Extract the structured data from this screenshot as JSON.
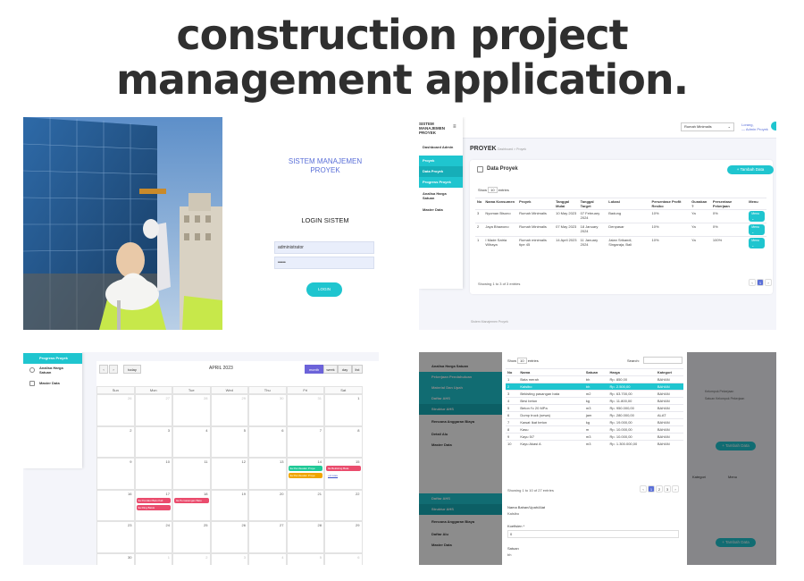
{
  "headline": {
    "line1": "construction project",
    "line2": "management application."
  },
  "login": {
    "title": "SISTEM MANAJEMEN PROYEK",
    "subtitle": "LOGIN SISTEM",
    "username_value": "administrator",
    "password_value": "•••••",
    "button_label": "LOGIN"
  },
  "proyek": {
    "sidebar_title": "SISTEM MANAJEMEN PROYEK",
    "sidebar_items": [
      "Dashboard Admin",
      "Proyek",
      "Data Proyek",
      "Progress Proyek",
      "Analisa Harga Satuan",
      "Master Data"
    ],
    "top_select": "Rumah Minimalis",
    "user_line1": "Lorang,",
    "user_line2": "— Admin Proyek",
    "page_title": "PROYEK",
    "breadcrumb": "Dashboard  >  Proyek",
    "card_title": "Data Proyek",
    "add_button": "+ Tambah Data",
    "show_label": "Show",
    "show_value": "10",
    "entries_label": "entries",
    "columns": [
      "No",
      "Nama Konsumen",
      "Proyek",
      "Tanggal Mulai",
      "Tanggal Target",
      "Lokasi",
      "Persentase Profit Resiko",
      "Gunakan ?",
      "Persentase Pekerjaan",
      "Menu"
    ],
    "rows": [
      [
        "3",
        "Nyoman Bisono",
        "Rumah Minimalis",
        "10 May 2023",
        "07 February 2024",
        "Badung",
        "10%",
        "Ya",
        "0%",
        "Menu ⌄"
      ],
      [
        "2",
        "Jaya Bhawono",
        "Rumah Minimalis",
        "07 May 2023",
        "18 January 2024",
        "Denpasar",
        "10%",
        "Ya",
        "0%",
        "Menu ⌄"
      ],
      [
        "1",
        "I Made Satria Wihaya",
        "Rumah minimalis tipe 45",
        "14 April 2023",
        "11 January 2024",
        "Jalan Srikandi, Singaraja, Bali",
        "10%",
        "Ya",
        "100%",
        "Menu ⌄"
      ]
    ],
    "footer_info": "Showing 1 to 3 of 3 entries",
    "pager": [
      "‹",
      "1",
      "›"
    ],
    "page_footer": "Sistem Manajemen Proyek"
  },
  "calendar": {
    "sidebar_items": [
      "Progress Proyek",
      "Analisa Harga Satuan",
      "Master Data"
    ],
    "nav": [
      "‹",
      "›",
      "today"
    ],
    "title": "APRIL 2023",
    "views": [
      "month",
      "week",
      "day",
      "list"
    ],
    "weekdays": [
      "Sun",
      "Mon",
      "Tue",
      "Wed",
      "Thu",
      "Fri",
      "Sat"
    ],
    "weeks": [
      [
        "26",
        "27",
        "28",
        "29",
        "30",
        "31",
        "1"
      ],
      [
        "2",
        "3",
        "4",
        "5",
        "6",
        "7",
        "8"
      ],
      [
        "9",
        "10",
        "11",
        "12",
        "13",
        "14",
        "15"
      ],
      [
        "16",
        "17",
        "18",
        "19",
        "20",
        "21",
        "22"
      ],
      [
        "23",
        "24",
        "25",
        "26",
        "27",
        "28",
        "29"
      ],
      [
        "30",
        "1",
        "2",
        "3",
        "4",
        "5",
        "6"
      ]
    ],
    "events": [
      {
        "label": "9a Pembuatan Proye",
        "color": "#20c997"
      },
      {
        "label": "9a Pembuatan Proye",
        "color": "#f0a500"
      },
      {
        "label": "9a Bekisting Bata",
        "color": "#ea4c6d"
      },
      {
        "label": "+2 more",
        "color": "#ffffff"
      },
      {
        "label": "9a Pondasi Batu Kali",
        "color": "#ea4c6d"
      },
      {
        "label": "9a Ring Balok",
        "color": "#ea4c6d"
      },
      {
        "label": "9a Pemasangan Batu",
        "color": "#ea4c6d"
      }
    ]
  },
  "material": {
    "sidebar_items": [
      "Analisa Harga Satuan",
      "Pekerjaan Pendahuluan",
      "Material Dan Upah",
      "Daftar AHS",
      "Struktur AHS",
      "Rencana Anggaran Biaya",
      "Detail Alu",
      "Master Data"
    ],
    "sidebar_bottom": [
      "Daftar AHS",
      "Struktur AHS",
      "Rencana Anggaran Biaya",
      "Daftar Alu",
      "Master Data"
    ],
    "show_label": "Show",
    "show_value": "10",
    "entries_label": "entries",
    "search_label": "Search:",
    "columns": [
      "No",
      "Nama",
      "Satuan",
      "Harga",
      "Kategori"
    ],
    "rows": [
      [
        "1",
        "Bata merah",
        "bh",
        "Rp. 850,00",
        "BAHAN"
      ],
      [
        "2",
        "Kalsibo",
        "bh",
        "Rp. 2.500,00",
        "BAHAN"
      ],
      [
        "3",
        "Bekisting pasangan bata",
        "m2",
        "Rp. 63.700,00",
        "BAHAN"
      ],
      [
        "4",
        "Besi beton",
        "kg",
        "Rp. 11.800,00",
        "BAHAN"
      ],
      [
        "5",
        "Beton f'c 20 MPa",
        "m3",
        "Rp. 950.000,00",
        "BAHAN"
      ],
      [
        "6",
        "Dump truck (sewa)",
        "jam",
        "Rp. 280.000,00",
        "ALAT"
      ],
      [
        "7",
        "Kawat Ikat beton",
        "kg",
        "Rp. 19.000,00",
        "BAHAN"
      ],
      [
        "8",
        "Kasu",
        "m",
        "Rp. 10.000,00",
        "BAHAN"
      ],
      [
        "9",
        "Kayu 5/7",
        "m3",
        "Rp. 10.000,00",
        "BAHAN"
      ],
      [
        "10",
        "Kayu Akasi A",
        "m3",
        "Rp. 1.300.000,00",
        "BAHAN"
      ]
    ],
    "footer_info": "Showing 1 to 10 of 27 entries",
    "pager": [
      "‹",
      "1",
      "2",
      "3",
      "›"
    ],
    "form_label1": "Nama Bahan/Upah/Alat",
    "form_value1": "Kalsibo",
    "form_label2": "Koefisien *",
    "form_value2": "0",
    "form_label3": "Satuan",
    "form_value3": "bh",
    "bg_add_button": "+ Tambah Data",
    "bg_label": "Kategori",
    "bg_menu": "Menu",
    "bg_text1": "Kelompok Pekerjaan",
    "bg_text2": "Satuan Kelompok Pekerjaan"
  }
}
